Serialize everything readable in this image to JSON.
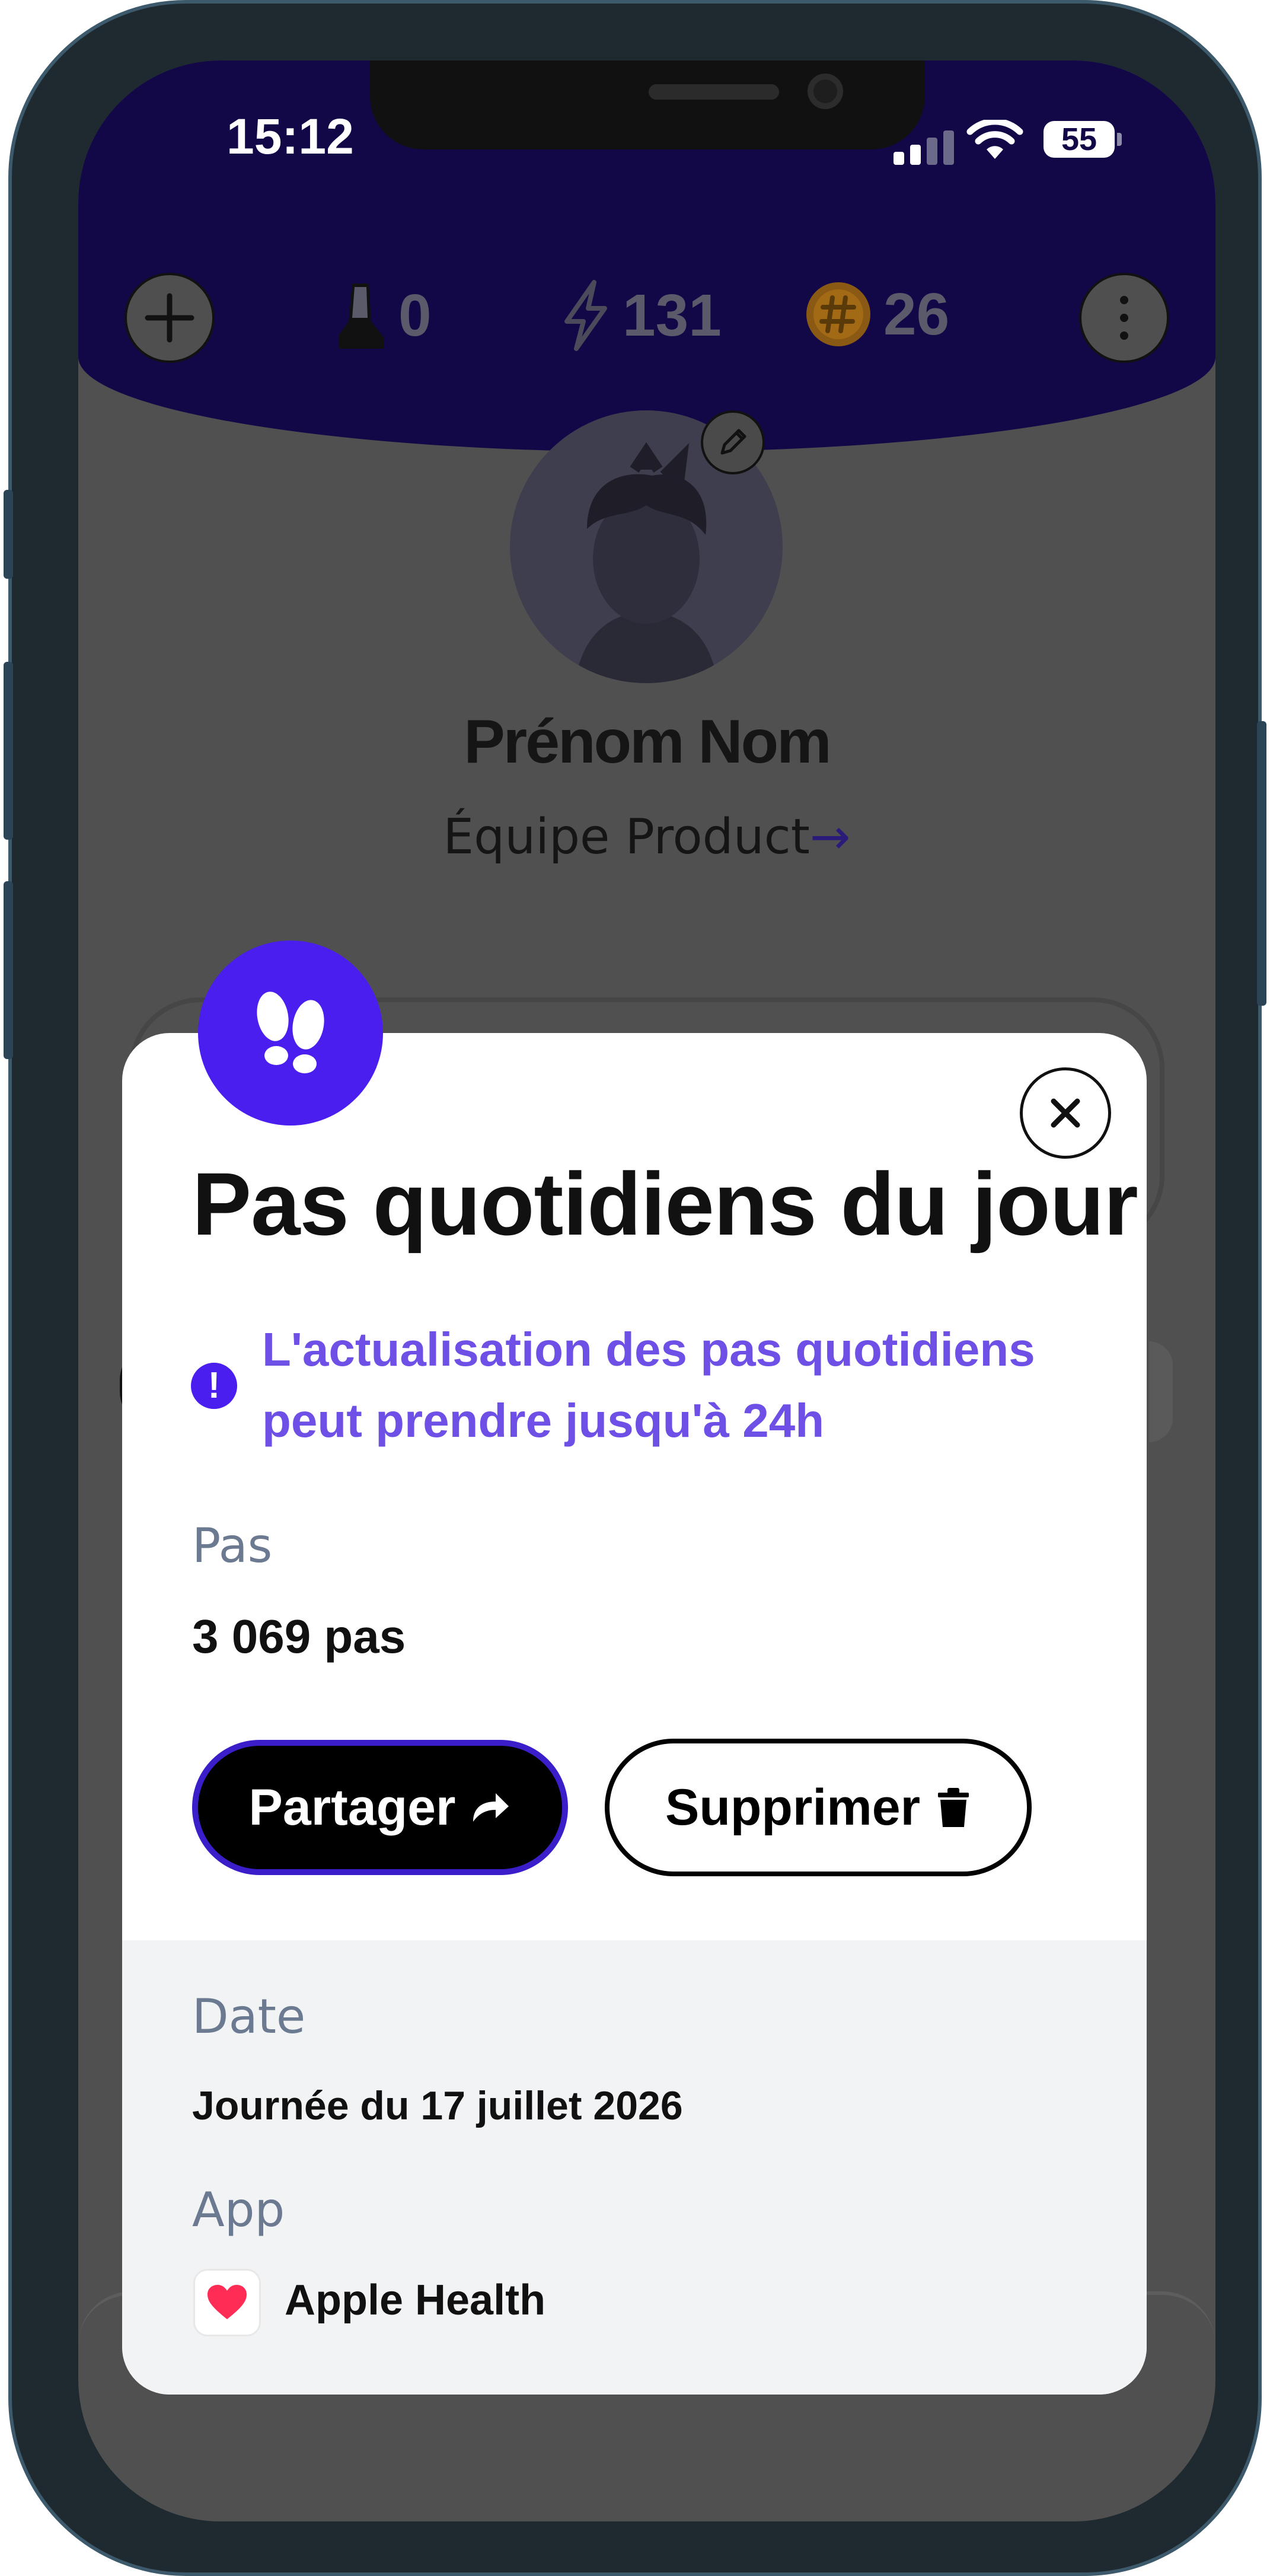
{
  "status_bar": {
    "time": "15:12",
    "battery": "55"
  },
  "header_stats": {
    "steps_count": "0",
    "energy_count": "131",
    "coins_count": "26"
  },
  "profile": {
    "name": "Prénom Nom",
    "team": "Équipe Product",
    "team_arrow": "→"
  },
  "modal": {
    "title": "Pas quotidiens du jour",
    "info_text": "L'actualisation des pas quotidiens peut prendre jusqu'à 24h",
    "steps_label": "Pas",
    "steps_value": "3 069 pas",
    "share_label": "Partager",
    "delete_label": "Supprimer",
    "date_label": "Date",
    "date_value": "Journée du 17 juillet 2026",
    "app_label": "App",
    "app_value": "Apple Health"
  },
  "colors": {
    "header_bg": "#120747",
    "accent": "#4b1ef0",
    "info_text": "#6e50e6"
  },
  "icons": [
    "plus-icon",
    "sneaker-icon",
    "bolt-icon",
    "coin-icon",
    "more-vertical-icon",
    "pencil-icon",
    "footprints-icon",
    "close-icon",
    "info-icon",
    "share-arrow-icon",
    "trash-icon",
    "heart-icon"
  ]
}
